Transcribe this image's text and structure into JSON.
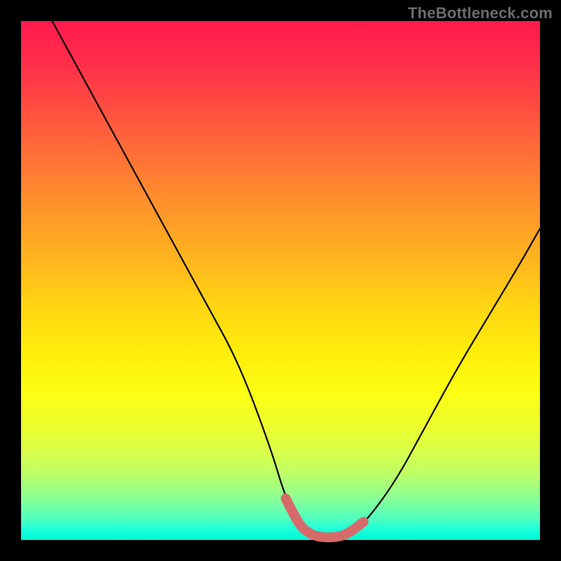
{
  "watermark": "TheBottleneck.com",
  "colors": {
    "frame": "#000000",
    "curve": "#000000",
    "marker": "#d66a6a",
    "gradient_top": "#ff1a4d",
    "gradient_bottom": "#00f7d3"
  },
  "chart_data": {
    "type": "line",
    "title": "",
    "xlabel": "",
    "ylabel": "",
    "xlim": [
      0,
      100
    ],
    "ylim": [
      0,
      100
    ],
    "grid": false,
    "legend": false,
    "series": [
      {
        "name": "bottleneck-curve",
        "x": [
          6,
          12,
          18,
          24,
          30,
          36,
          42,
          48,
          51,
          54,
          57,
          60,
          63,
          66,
          72,
          78,
          84,
          90,
          96,
          100
        ],
        "y": [
          100,
          89,
          78,
          67,
          56,
          45,
          34,
          18,
          8,
          2,
          0.5,
          0.5,
          1,
          3,
          11,
          22,
          33,
          43,
          53,
          60
        ]
      },
      {
        "name": "optimal-range-marker",
        "x": [
          51,
          52.5,
          54,
          55.5,
          57,
          58.5,
          60,
          61.5,
          63,
          64.5,
          66
        ],
        "y": [
          8,
          5,
          2.5,
          1.3,
          0.7,
          0.5,
          0.5,
          0.7,
          1.3,
          2.3,
          3.5
        ]
      }
    ],
    "annotations": []
  }
}
